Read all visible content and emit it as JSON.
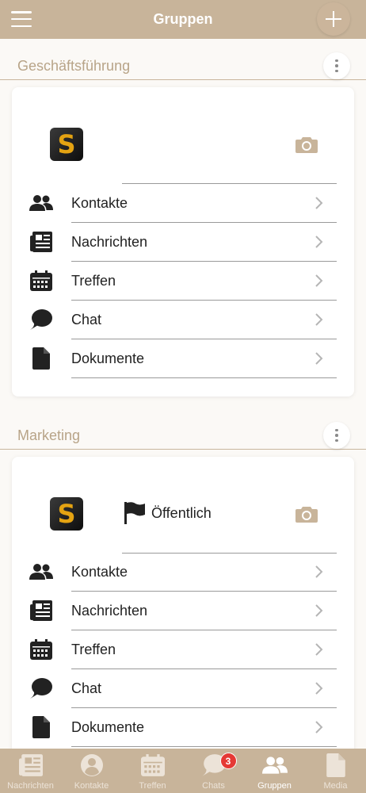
{
  "header": {
    "title": "Gruppen"
  },
  "groups": [
    {
      "name": "Geschäftsführung",
      "logo_letter": "S",
      "visibility": null,
      "items": [
        {
          "label": "Kontakte",
          "icon": "contacts-icon"
        },
        {
          "label": "Nachrichten",
          "icon": "newspaper-icon"
        },
        {
          "label": "Treffen",
          "icon": "calendar-icon"
        },
        {
          "label": "Chat",
          "icon": "chat-icon"
        },
        {
          "label": "Dokumente",
          "icon": "document-icon"
        }
      ]
    },
    {
      "name": "Marketing",
      "logo_letter": "S",
      "visibility": "Öffentlich",
      "items": [
        {
          "label": "Kontakte",
          "icon": "contacts-icon"
        },
        {
          "label": "Nachrichten",
          "icon": "newspaper-icon"
        },
        {
          "label": "Treffen",
          "icon": "calendar-icon"
        },
        {
          "label": "Chat",
          "icon": "chat-icon"
        },
        {
          "label": "Dokumente",
          "icon": "document-icon"
        }
      ]
    }
  ],
  "tabbar": {
    "tabs": [
      {
        "label": "Nachrichten",
        "icon": "newspaper-icon"
      },
      {
        "label": "Kontakte",
        "icon": "person-icon"
      },
      {
        "label": "Treffen",
        "icon": "calendar-icon"
      },
      {
        "label": "Chats",
        "icon": "chat-icon",
        "badge": "3"
      },
      {
        "label": "Gruppen",
        "icon": "group-icon",
        "active": true
      },
      {
        "label": "Media",
        "icon": "document-icon"
      }
    ]
  },
  "colors": {
    "brand": "#c8b49a",
    "section_title": "#b8a488",
    "badge": "#e53935",
    "logo_letter": "#e4a312"
  }
}
